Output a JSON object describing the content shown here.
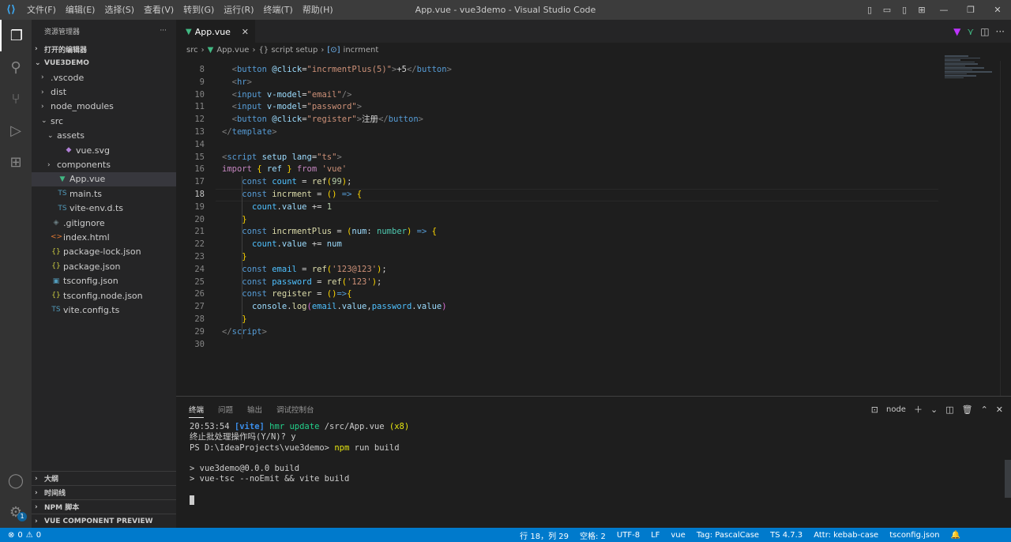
{
  "titlebar": {
    "menu": [
      "文件(F)",
      "编辑(E)",
      "选择(S)",
      "查看(V)",
      "转到(G)",
      "运行(R)",
      "终端(T)",
      "帮助(H)"
    ],
    "title": "App.vue - vue3demo - Visual Studio Code"
  },
  "sidebar": {
    "title": "资源管理器",
    "more": "···",
    "open_editors": "打开的编辑器",
    "project": "VUE3DEMO",
    "items": [
      {
        "label": ".vscode",
        "type": "folder",
        "depth": 1,
        "open": false
      },
      {
        "label": "dist",
        "type": "folder",
        "depth": 1,
        "open": false
      },
      {
        "label": "node_modules",
        "type": "folder",
        "depth": 1,
        "open": false
      },
      {
        "label": "src",
        "type": "folder",
        "depth": 1,
        "open": true
      },
      {
        "label": "assets",
        "type": "folder",
        "depth": 2,
        "open": true
      },
      {
        "label": "vue.svg",
        "type": "svg",
        "depth": 3
      },
      {
        "label": "components",
        "type": "folder",
        "depth": 2,
        "open": false
      },
      {
        "label": "App.vue",
        "type": "vue",
        "depth": 2,
        "selected": true
      },
      {
        "label": "main.ts",
        "type": "ts",
        "depth": 2
      },
      {
        "label": "vite-env.d.ts",
        "type": "ts",
        "depth": 2
      },
      {
        "label": ".gitignore",
        "type": "git",
        "depth": 1
      },
      {
        "label": "index.html",
        "type": "html",
        "depth": 1
      },
      {
        "label": "package-lock.json",
        "type": "json",
        "depth": 1
      },
      {
        "label": "package.json",
        "type": "json",
        "depth": 1
      },
      {
        "label": "tsconfig.json",
        "type": "tsjson",
        "depth": 1
      },
      {
        "label": "tsconfig.node.json",
        "type": "json",
        "depth": 1
      },
      {
        "label": "vite.config.ts",
        "type": "ts",
        "depth": 1
      }
    ],
    "bottom_sections": [
      "大纲",
      "时间线",
      "NPM 脚本",
      "VUE COMPONENT PREVIEW"
    ]
  },
  "editor": {
    "tab_label": "App.vue",
    "tab_close": "✕",
    "breadcrumb": {
      "src": "src",
      "file": "App.vue",
      "script": "{} script setup",
      "symbol": "incrment"
    },
    "current_line": 18,
    "lines": [
      {
        "n": 8,
        "html": "  <span class='t-bracket'>&lt;</span><span class='t-tag'>button</span> <span class='t-attr'>@click</span><span class='t-op'>=</span><span class='t-str'>\"incrmentPlus(5)\"</span><span class='t-bracket'>&gt;</span>+5<span class='t-bracket'>&lt;/</span><span class='t-tag'>button</span><span class='t-bracket'>&gt;</span>"
      },
      {
        "n": 9,
        "html": "  <span class='t-bracket'>&lt;</span><span class='t-tag'>hr</span><span class='t-bracket'>&gt;</span>"
      },
      {
        "n": 10,
        "html": "  <span class='t-bracket'>&lt;</span><span class='t-tag'>input</span> <span class='t-attr'>v-model</span><span class='t-op'>=</span><span class='t-str'>\"email\"</span><span class='t-bracket'>/&gt;</span>"
      },
      {
        "n": 11,
        "html": "  <span class='t-bracket'>&lt;</span><span class='t-tag'>input</span> <span class='t-attr'>v-model</span><span class='t-op'>=</span><span class='t-str'>\"password\"</span><span class='t-bracket'>&gt;</span>"
      },
      {
        "n": 12,
        "html": "  <span class='t-bracket'>&lt;</span><span class='t-tag'>button</span> <span class='t-attr'>@click</span><span class='t-op'>=</span><span class='t-str'>\"register\"</span><span class='t-bracket'>&gt;</span>注册<span class='t-bracket'>&lt;/</span><span class='t-tag'>button</span><span class='t-bracket'>&gt;</span>"
      },
      {
        "n": 13,
        "html": "<span class='t-bracket'>&lt;/</span><span class='t-tag'>template</span><span class='t-bracket'>&gt;</span>"
      },
      {
        "n": 14,
        "html": ""
      },
      {
        "n": 15,
        "html": "<span class='t-bracket'>&lt;</span><span class='t-tag'>script</span> <span class='t-attr'>setup</span> <span class='t-attr'>lang</span><span class='t-op'>=</span><span class='t-str'>\"ts\"</span><span class='t-bracket'>&gt;</span>"
      },
      {
        "n": 16,
        "html": "<span class='t-ctl'>import</span> <span class='t-p1'>{</span> <span class='t-var'>ref</span> <span class='t-p1'>}</span> <span class='t-ctl'>from</span> <span class='t-str'>'vue'</span>"
      },
      {
        "n": 17,
        "html": "    <span class='t-kw'>const</span> <span class='t-const'>count</span> <span class='t-op'>=</span> <span class='t-fn'>ref</span><span class='t-p1'>(</span><span class='t-num'>99</span><span class='t-p1'>)</span>;"
      },
      {
        "n": 18,
        "html": "    <span class='t-kw'>const</span> <span class='t-fn'>incrment</span> <span class='t-op'>=</span> <span class='t-p1'>()</span> <span class='t-kw'>=&gt;</span> <span class='t-p1'>{</span>"
      },
      {
        "n": 19,
        "html": "      <span class='t-const'>count</span>.<span class='t-var'>value</span> <span class='t-op'>+=</span> <span class='t-num'>1</span>"
      },
      {
        "n": 20,
        "html": "    <span class='t-p1'>}</span>"
      },
      {
        "n": 21,
        "html": "    <span class='t-kw'>const</span> <span class='t-fn'>incrmentPlus</span> <span class='t-op'>=</span> <span class='t-p1'>(</span><span class='t-var'>num</span>: <span class='t-type'>number</span><span class='t-p1'>)</span> <span class='t-kw'>=&gt;</span> <span class='t-p1'>{</span>"
      },
      {
        "n": 22,
        "html": "      <span class='t-const'>count</span>.<span class='t-var'>value</span> <span class='t-op'>+=</span> <span class='t-var'>num</span>"
      },
      {
        "n": 23,
        "html": "    <span class='t-p1'>}</span>"
      },
      {
        "n": 24,
        "html": "    <span class='t-kw'>const</span> <span class='t-const'>email</span> <span class='t-op'>=</span> <span class='t-fn'>ref</span><span class='t-p1'>(</span><span class='t-str'>'123@123'</span><span class='t-p1'>)</span>;"
      },
      {
        "n": 25,
        "html": "    <span class='t-kw'>const</span> <span class='t-const'>password</span> <span class='t-op'>=</span> <span class='t-fn'>ref</span><span class='t-p1'>(</span><span class='t-str'>'123'</span><span class='t-p1'>)</span>;"
      },
      {
        "n": 26,
        "html": "    <span class='t-kw'>const</span> <span class='t-fn'>register</span> <span class='t-op'>=</span> <span class='t-p1'>()</span><span class='t-kw'>=&gt;</span><span class='t-p1'>{</span>"
      },
      {
        "n": 27,
        "html": "      <span class='t-var'>console</span>.<span class='t-fn'>log</span><span class='t-p2'>(</span><span class='t-const'>email</span>.<span class='t-var'>value</span>,<span class='t-const'>password</span>.<span class='t-var'>value</span><span class='t-p2'>)</span>"
      },
      {
        "n": 28,
        "html": "    <span class='t-p1'>}</span>"
      },
      {
        "n": 29,
        "html": "<span class='t-bracket'>&lt;/</span><span class='t-tag'>script</span><span class='t-bracket'>&gt;</span>"
      },
      {
        "n": 30,
        "html": ""
      }
    ]
  },
  "panel": {
    "tabs": [
      "终端",
      "问题",
      "输出",
      "调试控制台"
    ],
    "shell": "node",
    "terminal_lines": [
      "<span>20:53:54 </span><span style='color:#3b8eea;font-weight:bold'>[vite]</span> <span style='color:#23d18b'>hmr update</span> <span>/src/App.vue </span><span style='color:#e5e510'>(x8)</span>",
      "终止批处理操作吗(Y/N)? y",
      "PS D:\\IdeaProjects\\vue3demo> <span style='color:#e5e510'>npm</span> run build",
      "",
      "> vue3demo@0.0.0 build",
      "> vue-tsc --noEmit && vite build"
    ]
  },
  "statusbar": {
    "errors": "0",
    "warnings": "0",
    "items": [
      "行 18，列 29",
      "空格: 2",
      "UTF-8",
      "LF",
      "vue",
      "Tag: PascalCase",
      "TS 4.7.3",
      "Attr: kebab-case",
      "tsconfig.json"
    ]
  }
}
